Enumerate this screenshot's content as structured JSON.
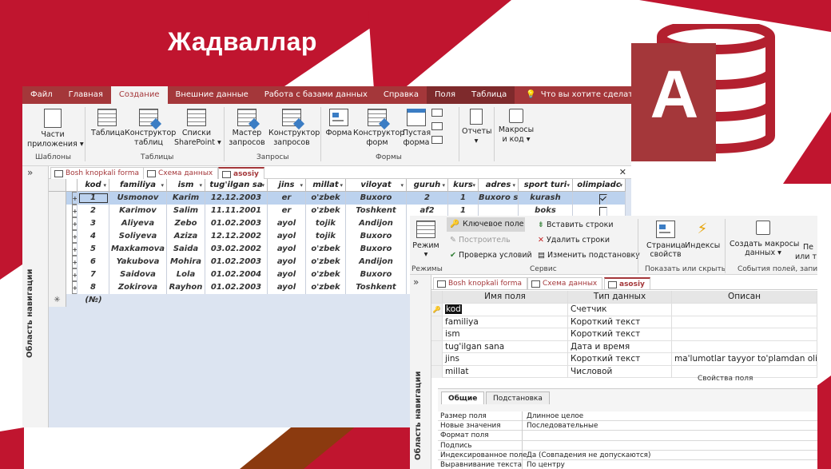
{
  "slide": {
    "title": "Жадваллар",
    "colors": {
      "accent": "#c0152f",
      "access_red": "#a4373a",
      "bronze": "#8b3a0f"
    }
  },
  "logo": {
    "letter": "A"
  },
  "window1": {
    "tabs": [
      {
        "label": "Файл"
      },
      {
        "label": "Главная"
      },
      {
        "label": "Создание",
        "active": true
      },
      {
        "label": "Внешние данные"
      },
      {
        "label": "Работа с базами данных"
      },
      {
        "label": "Справка"
      },
      {
        "label": "Поля"
      },
      {
        "label": "Таблица"
      }
    ],
    "tell_me": "Что вы хотите сделать?",
    "ribbon": {
      "parts_line1": "Части",
      "parts_line2": "приложения ▾",
      "group_templates": "Шаблоны",
      "table": "Таблица",
      "table_designer_1": "Конструктор",
      "table_designer_2": "таблиц",
      "sharepoint_1": "Списки",
      "sharepoint_2": "SharePoint ▾",
      "group_tables": "Таблицы",
      "query_wizard_1": "Мастер",
      "query_wizard_2": "запросов",
      "query_designer_1": "Конструктор",
      "query_designer_2": "запросов",
      "group_queries": "Запросы",
      "form": "Форма",
      "form_designer_1": "Конструктор",
      "form_designer_2": "форм",
      "blank_form_1": "Пустая",
      "blank_form_2": "форма",
      "group_forms": "Формы",
      "reports_1": "Отчеты",
      "reports_2": "▾",
      "macros_1": "Макросы",
      "macros_2": "и код ▾"
    },
    "object_tabs": [
      {
        "label": "Bosh knopkali forma"
      },
      {
        "label": "Схема данных"
      },
      {
        "label": "asosiy",
        "active": true
      }
    ],
    "nav_pane": "Область навигации",
    "columns": [
      "kod",
      "familiya",
      "ism",
      "tug'ilgan sa",
      "jins",
      "millat",
      "viloyat",
      "guruh",
      "kurs",
      "adres",
      "sport turi",
      "olimpiadc"
    ],
    "rows": [
      {
        "kod": "1",
        "familiya": "Usmonov",
        "ism": "Karim",
        "tug": "12.12.2003",
        "jins": "er",
        "millat": "o'zbek",
        "viloyat": "Buxoro",
        "guruh": "2",
        "kurs": "1",
        "adres": "Buxoro sh",
        "sport": "kurash",
        "olimp": true
      },
      {
        "kod": "2",
        "familiya": "Karimov",
        "ism": "Salim",
        "tug": "11.11.2001",
        "jins": "er",
        "millat": "o'zbek",
        "viloyat": "Toshkent",
        "guruh": "af2",
        "kurs": "1",
        "adres": "",
        "sport": "boks",
        "olimp": false
      },
      {
        "kod": "3",
        "familiya": "Aliyeva",
        "ism": "Zebo",
        "tug": "01.02.2003",
        "jins": "ayol",
        "millat": "tojik",
        "viloyat": "Andijon",
        "guruh": "",
        "kurs": "",
        "adres": "",
        "sport": "",
        "olimp": false
      },
      {
        "kod": "4",
        "familiya": "Soliyeva",
        "ism": "Aziza",
        "tug": "12.12.2002",
        "jins": "ayol",
        "millat": "tojik",
        "viloyat": "Buxoro",
        "guruh": "",
        "kurs": "",
        "adres": "",
        "sport": "",
        "olimp": false
      },
      {
        "kod": "5",
        "familiya": "Maxkamova",
        "ism": "Saida",
        "tug": "03.02.2002",
        "jins": "ayol",
        "millat": "o'zbek",
        "viloyat": "Buxoro",
        "guruh": "",
        "kurs": "",
        "adres": "",
        "sport": "",
        "olimp": false
      },
      {
        "kod": "6",
        "familiya": "Yakubova",
        "ism": "Mohira",
        "tug": "01.02.2003",
        "jins": "ayol",
        "millat": "o'zbek",
        "viloyat": "Andijon",
        "guruh": "",
        "kurs": "",
        "adres": "",
        "sport": "",
        "olimp": false
      },
      {
        "kod": "7",
        "familiya": "Saidova",
        "ism": "Lola",
        "tug": "01.02.2004",
        "jins": "ayol",
        "millat": "o'zbek",
        "viloyat": "Buxoro",
        "guruh": "",
        "kurs": "",
        "adres": "",
        "sport": "",
        "olimp": false
      },
      {
        "kod": "8",
        "familiya": "Zokirova",
        "ism": "Rayhon",
        "tug": "01.02.2003",
        "jins": "ayol",
        "millat": "o'zbek",
        "viloyat": "Toshkent",
        "guruh": "",
        "kurs": "",
        "adres": "",
        "sport": "",
        "olimp": false
      }
    ],
    "new_row": "(№)"
  },
  "window2": {
    "ribbon": {
      "mode_1": "Режим",
      "mode_2": "▾",
      "group_modes": "Режимы",
      "key_field": "Ключевое поле",
      "builder": "Построитель",
      "check_conditions": "Проверка условий",
      "insert_rows": "Вставить строки",
      "delete_rows": "Удалить строки",
      "change_lookup": "Изменить подстановку",
      "group_service": "Сервис",
      "property_sheet_1": "Страница",
      "property_sheet_2": "свойств",
      "indexes": "Индексы",
      "group_show": "Показать или скрыть",
      "create_macros_1": "Создать макросы",
      "create_macros_2": "данных ▾",
      "more_1": "Пе",
      "more_2": "или т",
      "group_events": "События полей, запи"
    },
    "object_tabs": [
      {
        "label": "Bosh knopkali forma"
      },
      {
        "label": "Схема данных"
      },
      {
        "label": "asosiy",
        "active": true
      }
    ],
    "nav_pane": "Область навигации",
    "headers": [
      "Имя поля",
      "Тип данных",
      "Описан"
    ],
    "fields": [
      {
        "name": "kod",
        "type": "Счетчик",
        "desc": "",
        "key": true
      },
      {
        "name": "familiya",
        "type": "Короткий текст",
        "desc": ""
      },
      {
        "name": "ism",
        "type": "Короткий текст",
        "desc": ""
      },
      {
        "name": "tug'ilgan sana",
        "type": "Дата и время",
        "desc": ""
      },
      {
        "name": "jins",
        "type": "Короткий текст",
        "desc": "ma'lumotlar tayyor to'plamdan oli"
      },
      {
        "name": "millat",
        "type": "Числовой",
        "desc": ""
      }
    ],
    "field_props_title": "Свойства поля",
    "prop_tabs": [
      "Общие",
      "Подстановка"
    ],
    "props": [
      {
        "name": "Размер поля",
        "value": "Длинное целое"
      },
      {
        "name": "Новые значения",
        "value": "Последовательные"
      },
      {
        "name": "Формат поля",
        "value": ""
      },
      {
        "name": "Подпись",
        "value": ""
      },
      {
        "name": "Индексированное поле",
        "value": "Да (Совпадения не допускаются)"
      },
      {
        "name": "Выравнивание текста",
        "value": "По центру"
      }
    ]
  }
}
